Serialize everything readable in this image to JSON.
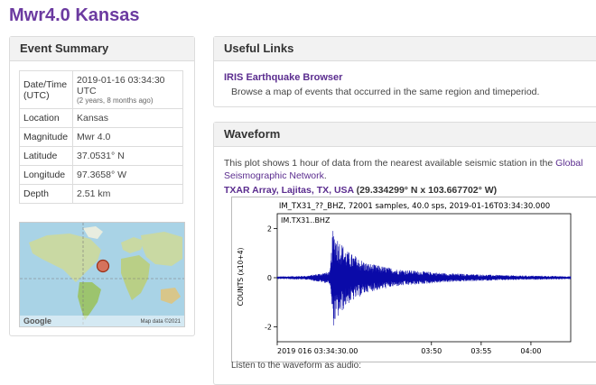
{
  "page": {
    "title": "Mwr4.0 Kansas"
  },
  "summary": {
    "heading": "Event Summary",
    "rows": [
      {
        "key": "Date/Time (UTC)",
        "value": "2019-01-16 03:34:30 UTC",
        "sub": "(2 years, 8 months ago)"
      },
      {
        "key": "Location",
        "value": "Kansas"
      },
      {
        "key": "Magnitude",
        "value": "Mwr 4.0"
      },
      {
        "key": "Latitude",
        "value": "37.0531° N"
      },
      {
        "key": "Longitude",
        "value": "97.3658° W"
      },
      {
        "key": "Depth",
        "value": "2.51 km"
      }
    ],
    "map": {
      "brand": "Google",
      "credit": "Map data ©2021"
    }
  },
  "links": {
    "heading": "Useful Links",
    "title": "IRIS Earthquake Browser",
    "desc": "Browse a map of events that occurred in the same region and timeperiod."
  },
  "waveform": {
    "heading": "Waveform",
    "text1": "This plot shows 1 hour of data from the nearest available seismic station in the",
    "link": "Global Seismographic Network",
    "text2": ".",
    "station": "TXAR Array, Lajitas, TX, USA",
    "coords": "(29.334299° N x 103.667702° W)",
    "audio": "Listen to the waveform as audio:"
  },
  "chart_data": {
    "type": "line",
    "title": "IM_TX31_??_BHZ, 72001 samples, 40.0 sps, 2019-01-16T03:34:30.000",
    "legend": "IM.TX31..BHZ",
    "ylabel": "COUNTS (x10+4)",
    "ylim": [
      -2.6,
      2.6
    ],
    "yticks": [
      2,
      0,
      -2
    ],
    "xlabels": [
      "2019 016 03:34:30.00",
      "03:50",
      "03:55",
      "04:00"
    ],
    "xlabel_positions_min": [
      0,
      15.5,
      20.5,
      25.5
    ],
    "xlim_min": [
      0,
      29.5
    ],
    "envelope": [
      {
        "t": 0,
        "amp": 0.05
      },
      {
        "t": 3.0,
        "amp": 0.08
      },
      {
        "t": 5.3,
        "amp": 0.25
      },
      {
        "t": 5.6,
        "amp": 2.0
      },
      {
        "t": 6.0,
        "amp": 1.7
      },
      {
        "t": 7.0,
        "amp": 1.1
      },
      {
        "t": 9.0,
        "amp": 0.6
      },
      {
        "t": 12.0,
        "amp": 0.35
      },
      {
        "t": 17.0,
        "amp": 0.18
      },
      {
        "t": 23.0,
        "amp": 0.1
      },
      {
        "t": 29.5,
        "amp": 0.06
      }
    ],
    "color": "#0a0aa8"
  },
  "colors": {
    "accent": "#5b2d8f",
    "title": "#6b3aa0",
    "marker": "#e05a3a"
  }
}
